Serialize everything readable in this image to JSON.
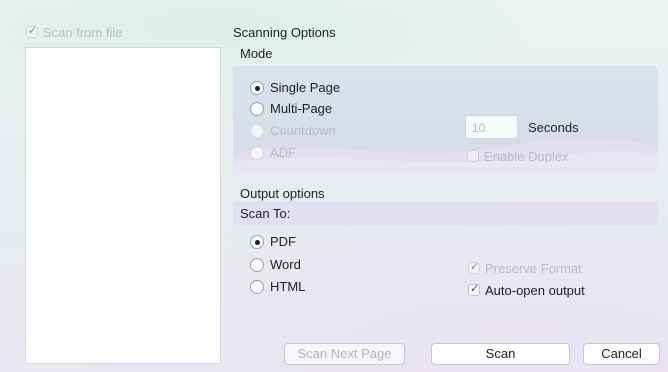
{
  "left_panel": {
    "scan_from_file_label": "Scan from file",
    "scan_from_file_checked": true
  },
  "scanning_options": {
    "title": "Scanning Options",
    "mode": {
      "title": "Mode",
      "options": [
        {
          "label": "Single Page",
          "selected": true,
          "enabled": true
        },
        {
          "label": "Multi-Page",
          "selected": false,
          "enabled": true
        },
        {
          "label": "Countdown",
          "selected": false,
          "enabled": false
        },
        {
          "label": "ADF",
          "selected": false,
          "enabled": false
        }
      ],
      "countdown_value": "10",
      "seconds_label": "Seconds",
      "enable_duplex_label": "Enable Duplex"
    },
    "output": {
      "title": "Output options",
      "scan_to_label": "Scan To:",
      "formats": [
        {
          "label": "PDF",
          "selected": true
        },
        {
          "label": "Word",
          "selected": false
        },
        {
          "label": "HTML",
          "selected": false
        }
      ],
      "preserve_format_label": "Preserve Format",
      "auto_open_label": "Auto-open output"
    }
  },
  "buttons": {
    "scan_next_page": "Scan Next Page",
    "scan": "Scan",
    "cancel": "Cancel"
  }
}
